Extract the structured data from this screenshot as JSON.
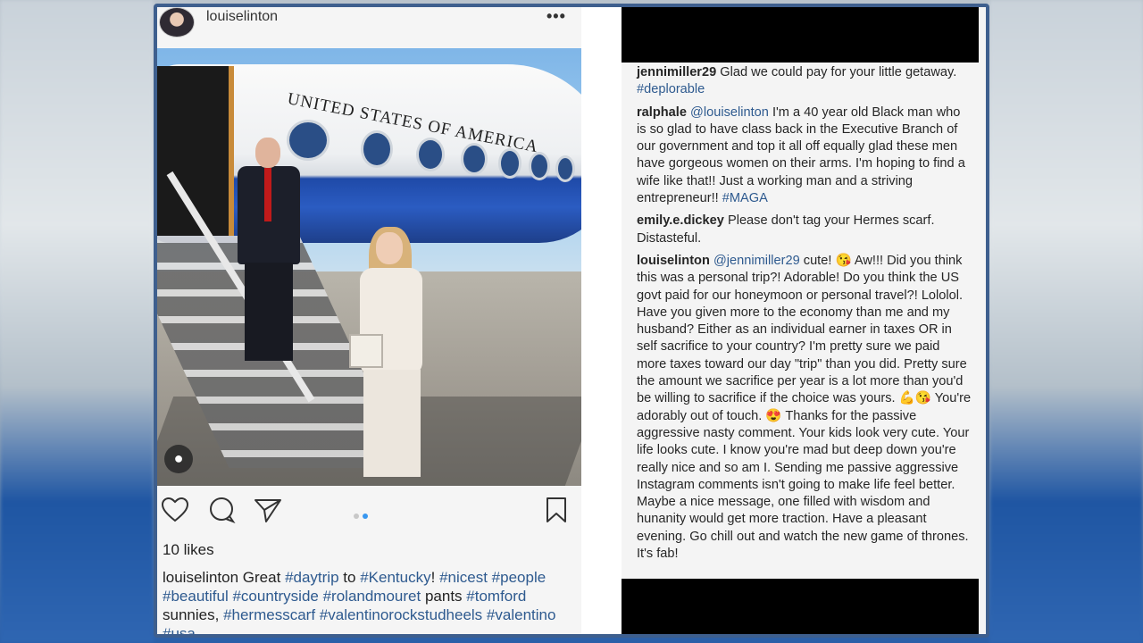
{
  "post": {
    "username": "louiselinton",
    "more_icon": "more-horizontal-icon",
    "photo_text": "UNITED STATES OF AMERICA",
    "actions": {
      "like_icon": "heart-icon",
      "comment_icon": "comment-icon",
      "share_icon": "send-icon",
      "save_icon": "bookmark-icon"
    },
    "carousel": {
      "total": 2,
      "active": 2
    },
    "likes": "10 likes",
    "caption": {
      "username": "louiselinton",
      "text_1": "Great",
      "tag_1": "#daytrip",
      "text_2": "to",
      "tag_2": "#Kentucky",
      "text_3": "!",
      "tag_3": "#nicest",
      "tag_4": "#people",
      "tag_5": "#beautiful",
      "tag_6": "#countryside",
      "tag_7": "#rolandmouret",
      "text_4": "pants",
      "tag_8": "#tomford",
      "text_5": "sunnies,",
      "tag_9": "#hermesscarf",
      "tag_10": "#valentinorockstudheels",
      "tag_11": "#valentino",
      "tag_12": "#usa"
    }
  },
  "comments": [
    {
      "username": "jennimiller29",
      "text": "Glad we could pay for your little getaway.",
      "tag": "#deplorable"
    },
    {
      "username": "ralphale",
      "mention": "@louiselinton",
      "text": "I'm a 40 year old Black man who is so glad to have class back in the Executive Branch of our government and top it all off equally glad these men have gorgeous women on their arms. I'm hoping to find a wife like that!! Just a working man and a striving entrepreneur!!",
      "tag": "#MAGA"
    },
    {
      "username": "emily.e.dickey",
      "text": "Please don't tag your Hermes scarf. Distasteful."
    },
    {
      "username": "louiselinton",
      "mention": "@jennimiller29",
      "text_a": "cute! 😘 Aw!!! Did you think this was a personal trip?! Adorable! Do you think the US govt paid for our honeymoon or personal travel?! Lololol. Have you given more to the economy than me and my husband? Either as an individual earner in taxes OR in self sacrifice to your country? I'm pretty sure we paid more taxes toward our day \"trip\" than you did. Pretty sure the amount we sacrifice per year is a lot more than you'd be willing to sacrifice if the choice was yours. 💪😘 You're adorably out of touch. 😍 Thanks for the passive aggressive nasty comment. Your kids look very cute. Your life looks cute. I know you're mad but deep down you're really nice and so am I. Sending me passive aggressive Instagram comments isn't going to make life feel better. Maybe a nice message, one filled with wisdom and hunanity would get more traction. Have a pleasant evening. Go chill out and watch the new game of thrones. It's fab!"
    }
  ],
  "colors": {
    "hashtag": "#2e5a8f",
    "carousel_active": "#3897f0",
    "frame": "#3e5f8e"
  }
}
